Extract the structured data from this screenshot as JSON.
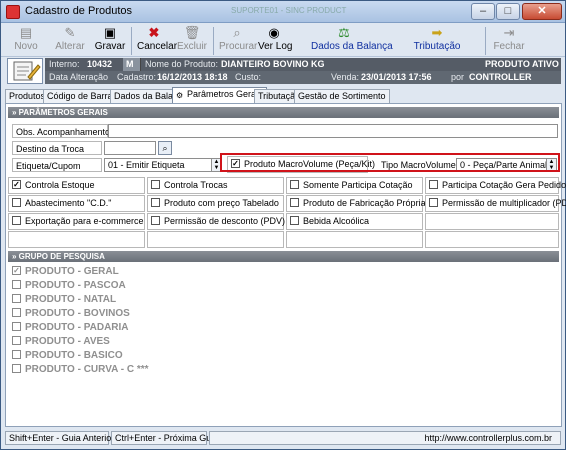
{
  "window": {
    "title": "Cadastro de Produtos",
    "faint_title": "SUPORTE01 - SINC PRODUCT",
    "close_label": "✕",
    "minimize_label": "–",
    "maximize_label": "□"
  },
  "toolbar": {
    "novo": "Novo",
    "alterar": "Alterar",
    "gravar": "Gravar",
    "cancelar": "Cancelar",
    "excluir": "Excluir",
    "procurar": "Procurar",
    "ver_log": "Ver Log",
    "dados_balanca": "Dados da Balança",
    "tributacao": "Tributação",
    "fechar": "Fechar"
  },
  "info": {
    "interno_label": "Interno:",
    "interno_value": "10432",
    "m": "M",
    "nome_label": "Nome do Produto:",
    "nome_value": "DIANTEIRO BOVINO KG",
    "status": "PRODUTO ATIVO",
    "data_alt_label": "Data Alteração",
    "cadastro_label": "Cadastro:",
    "cadastro_value": "16/12/2013  18:18",
    "custo_label": "Custo:",
    "venda_label": "Venda:",
    "venda_value": "23/01/2013 17:56",
    "por_label": "por",
    "por_value": "CONTROLLER"
  },
  "tabs": [
    "Produtos",
    "Código de Barras",
    "Dados da Balança",
    "Parâmetros Gerais",
    "Tributação",
    "Gestão de Sortimento"
  ],
  "section1": "» PARÂMETROS GERAIS",
  "obs_label": "Obs. Acompanhamento",
  "destino_label": "Destino da Troca",
  "etiqueta_label": "Etiqueta/Cupom",
  "etiqueta_value": "01 - Emitir Etiqueta",
  "macro_label": "Produto MacroVolume (Peça/Kit)",
  "tipo_macro_label": "Tipo MacroVolume",
  "tipo_macro_value": "0 - Peça/Parte Animal",
  "checks": [
    {
      "label": "Controla Estoque",
      "checked": true
    },
    {
      "label": "Controla Trocas",
      "checked": false
    },
    {
      "label": "Somente Participa Cotação",
      "checked": false
    },
    {
      "label": "Participa Cotação Gera Pedido",
      "checked": false
    },
    {
      "label": "Abastecimento \"C.D.\"",
      "checked": false
    },
    {
      "label": "Produto com preço Tabelado",
      "checked": false
    },
    {
      "label": "Produto de Fabricação Própria",
      "checked": false
    },
    {
      "label": "Permissão de multiplicador (PDV)",
      "checked": false
    },
    {
      "label": "Exportação para e-commerce",
      "checked": false
    },
    {
      "label": "Permissão de desconto (PDV)",
      "checked": false
    },
    {
      "label": "Bebida Alcoólica",
      "checked": false
    }
  ],
  "section2": "» GRUPO DE PESQUISA",
  "groups": [
    {
      "label": "PRODUTO - GERAL",
      "checked": true
    },
    {
      "label": "PRODUTO - PASCOA",
      "checked": false
    },
    {
      "label": "PRODUTO - NATAL",
      "checked": false
    },
    {
      "label": "PRODUTO - BOVINOS",
      "checked": false
    },
    {
      "label": "PRODUTO - PADARIA",
      "checked": false
    },
    {
      "label": "PRODUTO - AVES",
      "checked": false
    },
    {
      "label": "PRODUTO - BASICO",
      "checked": false
    },
    {
      "label": "PRODUTO - CURVA - C ***",
      "checked": false
    }
  ],
  "statusbar": {
    "prev": "Shift+Enter - Guia Anterior",
    "next": "Ctrl+Enter - Próxima Guia",
    "url": "http://www.controllerplus.com.br"
  },
  "colors": {
    "highlight": "#d0131a",
    "header": "#555c66"
  }
}
